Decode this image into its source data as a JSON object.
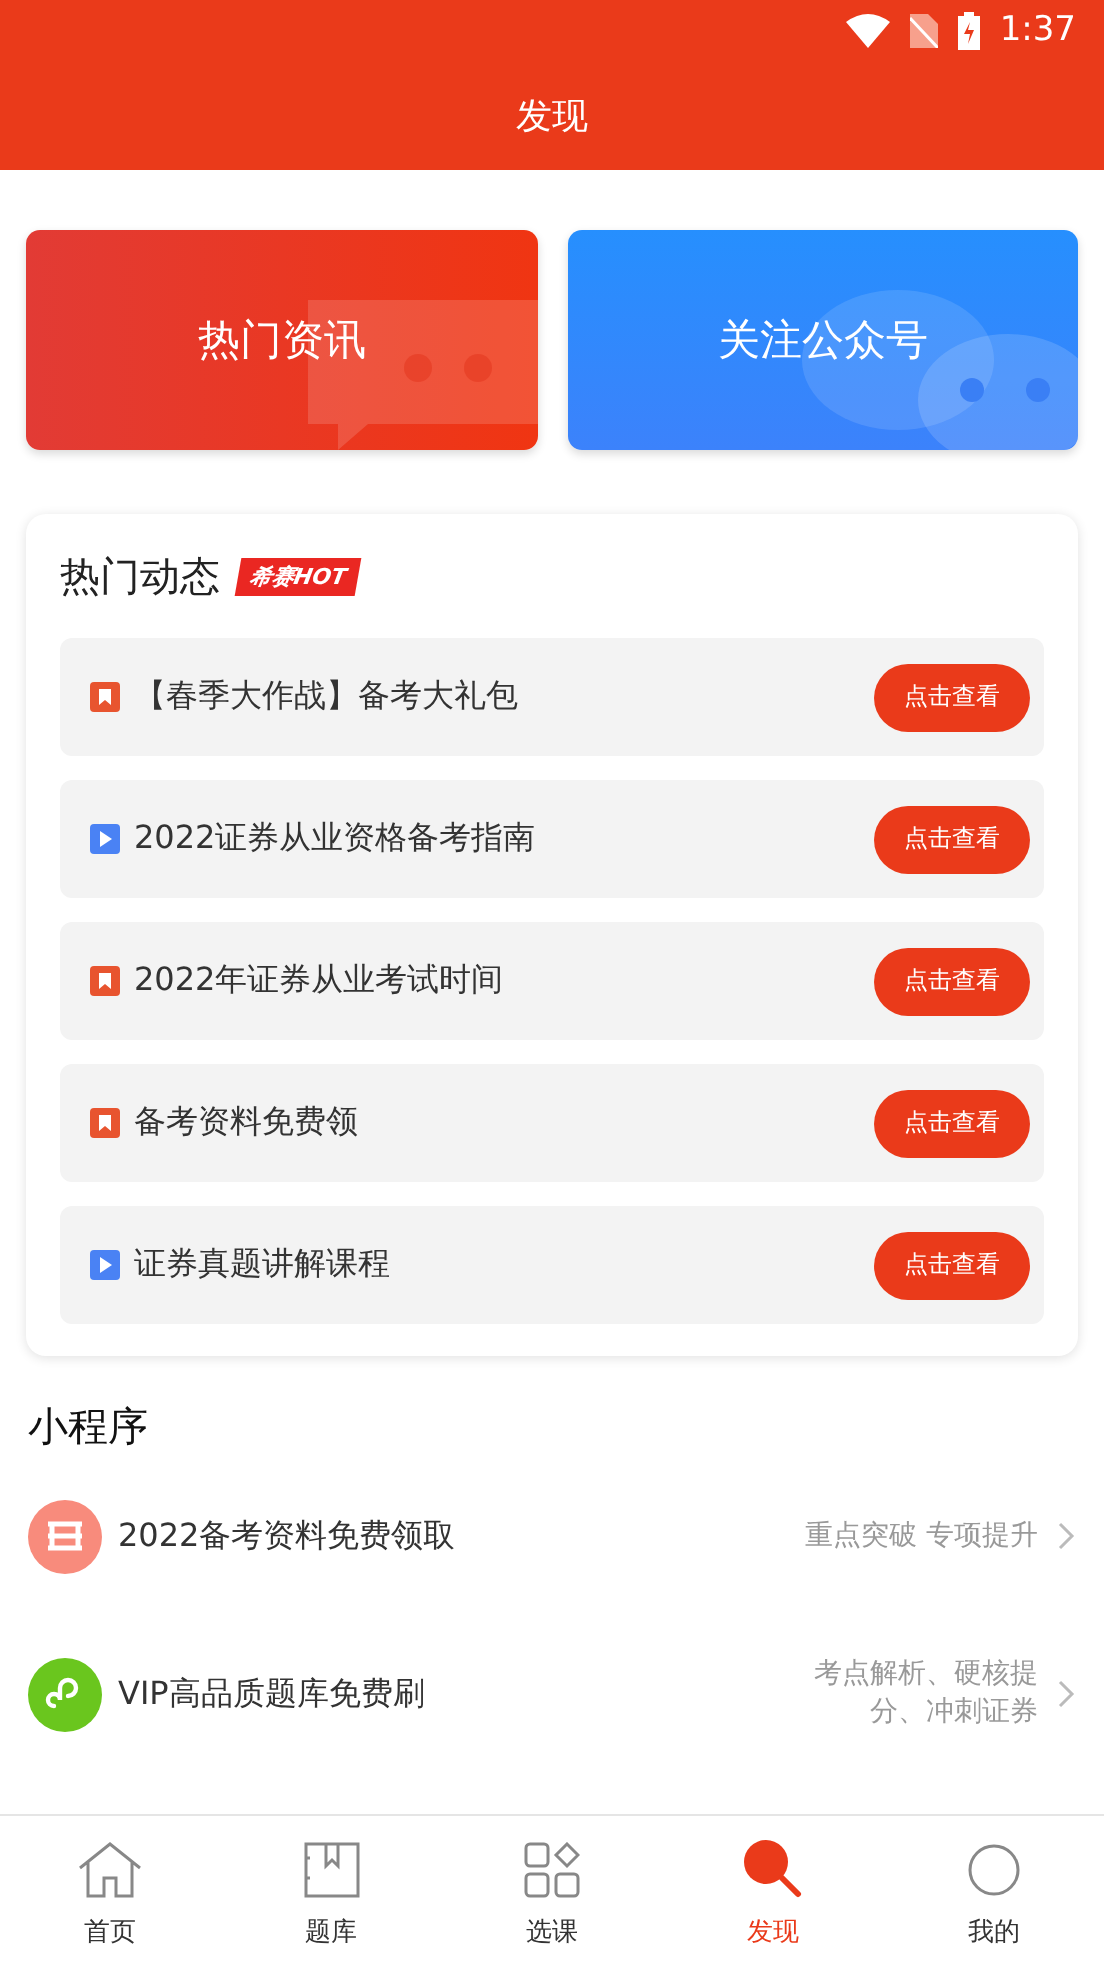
{
  "status_bar": {
    "time": "1:37"
  },
  "header": {
    "title": "发现"
  },
  "banners": [
    {
      "label": "热门资讯",
      "kind": "news"
    },
    {
      "label": "关注公众号",
      "kind": "wechat"
    }
  ],
  "hot": {
    "title": "热门动态",
    "badge": "希赛HOT",
    "items": [
      {
        "kind": "bookmark",
        "title": "【春季大作战】备考大礼包",
        "button": "点击查看"
      },
      {
        "kind": "video",
        "title": "2022证券从业资格备考指南",
        "button": "点击查看"
      },
      {
        "kind": "bookmark",
        "title": "2022年证券从业考试时间",
        "button": "点击查看"
      },
      {
        "kind": "bookmark",
        "title": "备考资料免费领",
        "button": "点击查看"
      },
      {
        "kind": "video",
        "title": "证券真题讲解课程",
        "button": "点击查看"
      }
    ]
  },
  "mini_programs": {
    "title": "小程序",
    "items": [
      {
        "kind": "books",
        "title": "2022备考资料免费领取",
        "subtitle": "重点突破 专项提升"
      },
      {
        "kind": "link",
        "title": "VIP高品质题库免费刷",
        "subtitle": "考点解析、硬核提分、冲刺证券"
      }
    ]
  },
  "tab_bar": [
    {
      "label": "首页",
      "kind": "home",
      "selected": false
    },
    {
      "label": "题库",
      "kind": "book",
      "selected": false
    },
    {
      "label": "选课",
      "kind": "grid",
      "selected": false
    },
    {
      "label": "发现",
      "kind": "search",
      "selected": true
    },
    {
      "label": "我的",
      "kind": "person",
      "selected": false
    }
  ]
}
